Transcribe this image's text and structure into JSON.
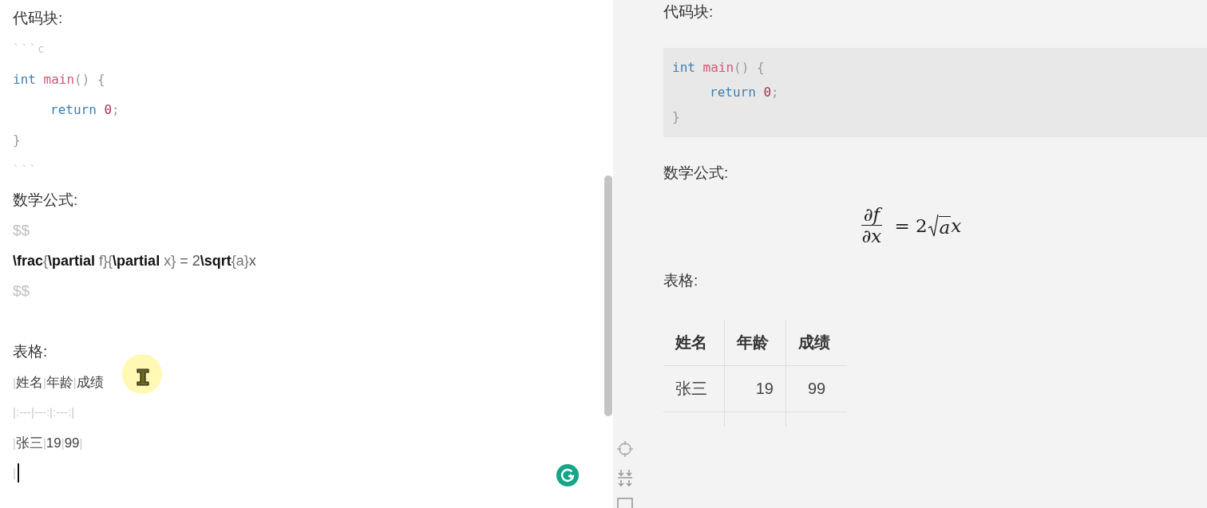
{
  "editor": {
    "lines": [
      {
        "kind": "heading",
        "text": "代码块:"
      },
      {
        "kind": "fence",
        "text": "```c"
      },
      {
        "kind": "code",
        "indented": false,
        "tokens": [
          {
            "kind": "keyword",
            "text": "int"
          },
          {
            "kind": "function",
            "text": " main"
          },
          {
            "kind": "punct",
            "text": "() {"
          }
        ]
      },
      {
        "kind": "code",
        "indented": true,
        "tokens": [
          {
            "kind": "keyword",
            "text": "return"
          },
          {
            "kind": "number",
            "text": " 0"
          },
          {
            "kind": "punct",
            "text": ";"
          }
        ]
      },
      {
        "kind": "code",
        "indented": false,
        "tokens": [
          {
            "kind": "punct",
            "text": "}"
          }
        ]
      },
      {
        "kind": "fence",
        "text": "```"
      },
      {
        "kind": "heading",
        "text": "数学公式:"
      },
      {
        "kind": "delim",
        "text": "$$"
      },
      {
        "kind": "latex",
        "tokens": [
          {
            "kind": "command",
            "text": "\\frac"
          },
          {
            "kind": "brace",
            "text": "{"
          },
          {
            "kind": "command",
            "text": "\\partial"
          },
          {
            "kind": "brace",
            "text": " f}{"
          },
          {
            "kind": "command",
            "text": "\\partial"
          },
          {
            "kind": "brace",
            "text": " x}"
          },
          {
            "kind": "plain",
            "text": " = 2"
          },
          {
            "kind": "command",
            "text": "\\sqrt"
          },
          {
            "kind": "brace",
            "text": "{a}"
          },
          {
            "kind": "plain",
            "text": "x"
          }
        ]
      },
      {
        "kind": "delim",
        "text": "$$"
      },
      {
        "kind": "blank"
      },
      {
        "kind": "heading",
        "text": "表格:"
      },
      {
        "kind": "table",
        "caret": false,
        "tokens": [
          {
            "kind": "pipe",
            "text": "|"
          },
          {
            "kind": "plain",
            "text": "姓名"
          },
          {
            "kind": "pipe",
            "text": "|"
          },
          {
            "kind": "plain",
            "text": "年龄"
          },
          {
            "kind": "pipe",
            "text": "|"
          },
          {
            "kind": "plain",
            "text": "成绩"
          }
        ]
      },
      {
        "kind": "table",
        "caret": false,
        "tokens": [
          {
            "kind": "pipe",
            "text": "|:---|---:|:---:|"
          }
        ]
      },
      {
        "kind": "table",
        "caret": false,
        "tokens": [
          {
            "kind": "pipe",
            "text": "|"
          },
          {
            "kind": "plain",
            "text": "张三"
          },
          {
            "kind": "pipe",
            "text": "|"
          },
          {
            "kind": "plain",
            "text": "19"
          },
          {
            "kind": "pipe",
            "text": "|"
          },
          {
            "kind": "plain",
            "text": "99"
          },
          {
            "kind": "pipe",
            "text": "|"
          }
        ]
      },
      {
        "kind": "table",
        "caret": true,
        "tokens": [
          {
            "kind": "pipe",
            "text": "|"
          }
        ]
      }
    ]
  },
  "preview": {
    "code_heading": "代码块:",
    "code_block": [
      {
        "indented": false,
        "tokens": [
          {
            "kind": "keyword",
            "text": "int"
          },
          {
            "kind": "function",
            "text": " main"
          },
          {
            "kind": "punct",
            "text": "() {"
          }
        ]
      },
      {
        "indented": true,
        "tokens": [
          {
            "kind": "keyword",
            "text": "return"
          },
          {
            "kind": "number",
            "text": " 0"
          },
          {
            "kind": "punct",
            "text": ";"
          }
        ]
      },
      {
        "indented": false,
        "tokens": [
          {
            "kind": "punct",
            "text": "}"
          }
        ]
      }
    ],
    "math_heading": "数学公式:",
    "formula": {
      "numerator": "∂f",
      "denominator": "∂x",
      "before_root": "= 2",
      "radicand": "a",
      "after_root": "x"
    },
    "table_heading": "表格:",
    "table": {
      "columns": [
        {
          "label": "姓名",
          "right_aligned": false,
          "centered": false
        },
        {
          "label": "年龄",
          "right_aligned": true,
          "centered": false
        },
        {
          "label": "成绩",
          "right_aligned": false,
          "centered": true
        }
      ],
      "rows": [
        [
          "张三",
          "19",
          "99"
        ]
      ]
    }
  }
}
